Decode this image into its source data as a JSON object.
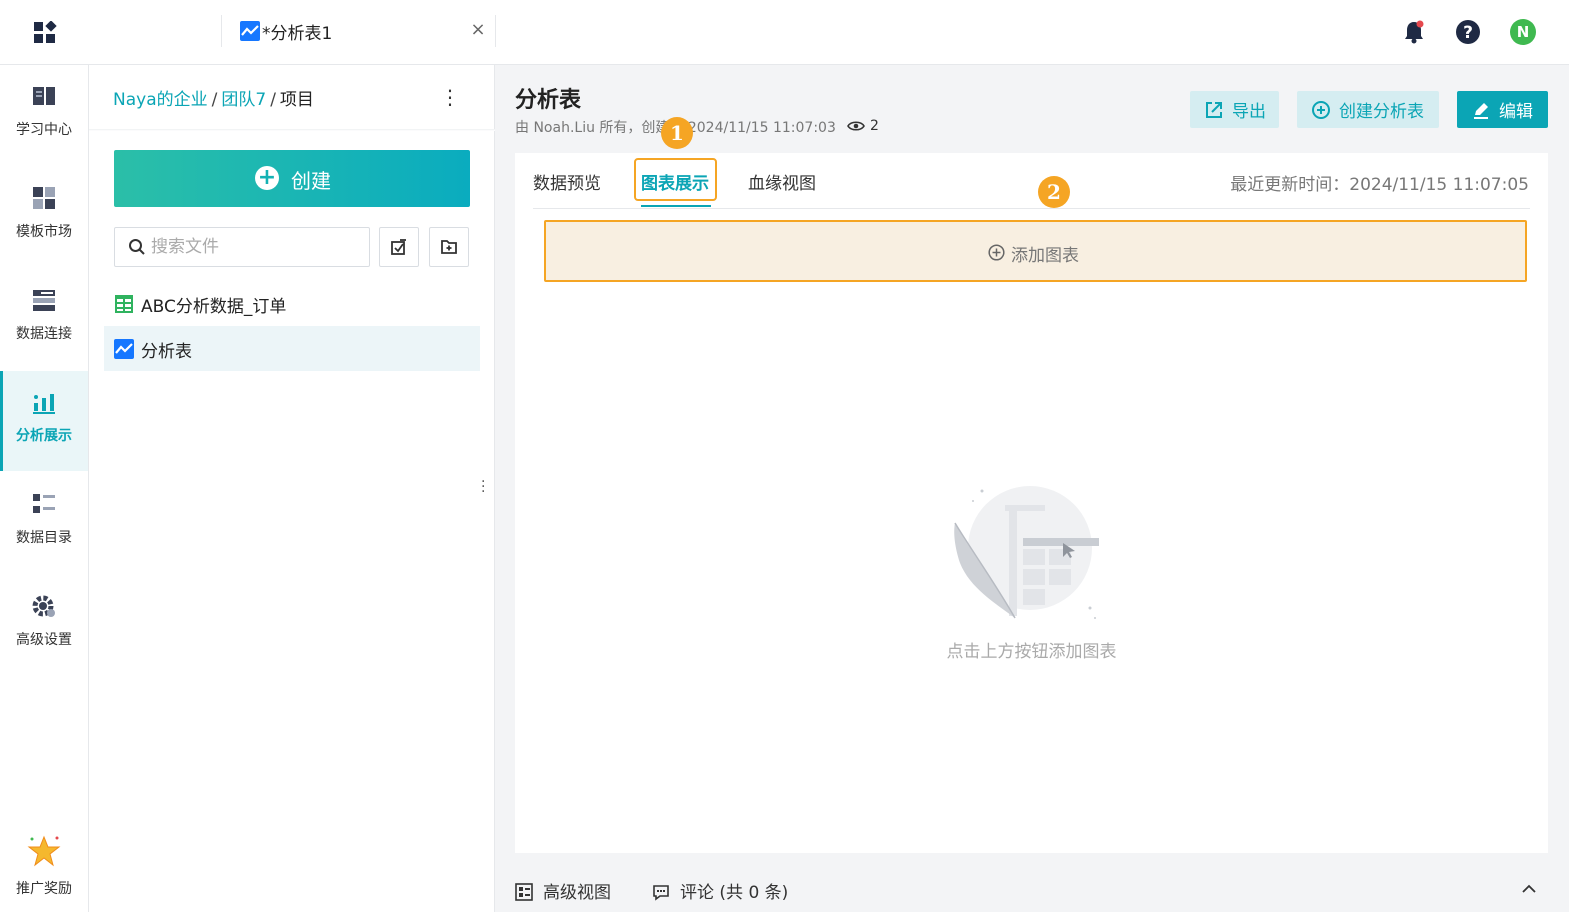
{
  "topbar": {
    "tab_label": "*分析表1",
    "icons": [
      "apps-icon",
      "bell-icon",
      "help-icon"
    ],
    "avatar_initial": "N",
    "avatar_color": "#3fb950"
  },
  "leftnav": {
    "items": [
      {
        "label": "学习中心",
        "icon": "book-icon"
      },
      {
        "label": "模板市场",
        "icon": "template-icon"
      },
      {
        "label": "数据连接",
        "icon": "data-connect-icon"
      },
      {
        "label": "分析展示",
        "icon": "analysis-icon",
        "active": true
      },
      {
        "label": "数据目录",
        "icon": "catalog-icon"
      },
      {
        "label": "高级设置",
        "icon": "settings-gear-icon"
      }
    ],
    "promo_label": "推广奖励"
  },
  "filepanel": {
    "breadcrumb": [
      "Naya的企业",
      "团队7",
      "项目"
    ],
    "create_label": "创建",
    "search_placeholder": "搜索文件",
    "files": [
      {
        "label": "ABC分析数据_订单",
        "icon": "spreadsheet-icon"
      },
      {
        "label": "分析表",
        "icon": "analysis-sheet-icon",
        "selected": true
      }
    ]
  },
  "main": {
    "title": "分析表",
    "subtitle": "由 Noah.Liu 所有，创建于 2024/11/15 11:07:03",
    "views": "2",
    "buttons": {
      "export": "导出",
      "new_sheet": "创建分析表",
      "edit": "编辑"
    },
    "tabs": [
      "数据预览",
      "图表展示",
      "血缘视图"
    ],
    "active_tab": "图表展示",
    "last_update": "最近更新时间：2024/11/15 11:07:05",
    "add_chart": "添加图表",
    "empty_text": "点击上方按钮添加图表",
    "badges": [
      "1",
      "2"
    ],
    "accent_color": "#0ba5b5",
    "highlight_color": "#f5a524"
  },
  "bottom": {
    "advanced_view": "高级视图",
    "comments": "评论 (共 0 条)"
  }
}
